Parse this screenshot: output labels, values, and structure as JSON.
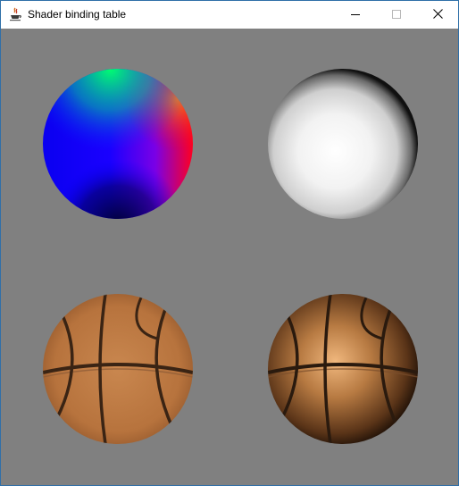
{
  "window": {
    "title": "Shader binding table",
    "app_icon": "java-cup-icon",
    "buttons": {
      "minimize": "minimize-icon",
      "maximize": "maximize-icon",
      "close": "close-icon"
    }
  },
  "viewport": {
    "background_color": "#808080",
    "spheres": [
      {
        "name": "normal-shaded-sphere",
        "style": "normals-rgb"
      },
      {
        "name": "lit-white-sphere",
        "style": "diffuse-white"
      },
      {
        "name": "textured-basketball-sphere",
        "style": "texture"
      },
      {
        "name": "lit-textured-basketball-sphere",
        "style": "texture-lit"
      }
    ]
  }
}
